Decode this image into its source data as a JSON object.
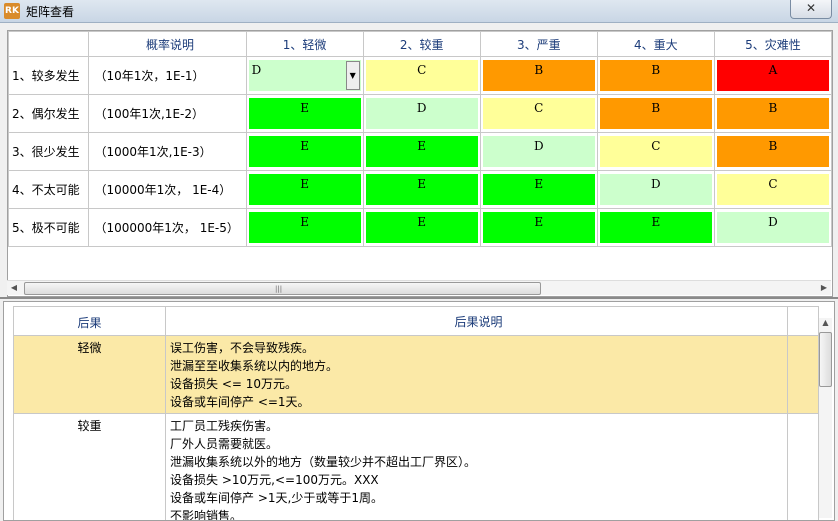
{
  "window": {
    "title": "矩阵查看",
    "icon": "app-icon",
    "close_label": "✕"
  },
  "matrix": {
    "headers": [
      "",
      "概率说明",
      "1、轻微",
      "2、较重",
      "3、严重",
      "4、重大",
      "5、灾难性"
    ],
    "rows": [
      {
        "label": "1、较多发生",
        "prob": "（10年1次，1E-1）",
        "cells": [
          {
            "v": "D",
            "color": "#ccffcc",
            "dropdown": true
          },
          {
            "v": "C",
            "color": "#ffff99"
          },
          {
            "v": "B",
            "color": "#ff9900"
          },
          {
            "v": "B",
            "color": "#ff9900"
          },
          {
            "v": "A",
            "color": "#ff0000"
          }
        ]
      },
      {
        "label": "2、偶尔发生",
        "prob": "（100年1次,1E-2）",
        "cells": [
          {
            "v": "E",
            "color": "#00ff00"
          },
          {
            "v": "D",
            "color": "#ccffcc"
          },
          {
            "v": "C",
            "color": "#ffff99"
          },
          {
            "v": "B",
            "color": "#ff9900"
          },
          {
            "v": "B",
            "color": "#ff9900"
          }
        ]
      },
      {
        "label": "3、很少发生",
        "prob": "（1000年1次,1E-3）",
        "cells": [
          {
            "v": "E",
            "color": "#00ff00"
          },
          {
            "v": "E",
            "color": "#00ff00"
          },
          {
            "v": "D",
            "color": "#ccffcc"
          },
          {
            "v": "C",
            "color": "#ffff99"
          },
          {
            "v": "B",
            "color": "#ff9900"
          }
        ]
      },
      {
        "label": "4、不太可能",
        "prob": "（10000年1次， 1E-4）",
        "cells": [
          {
            "v": "E",
            "color": "#00ff00"
          },
          {
            "v": "E",
            "color": "#00ff00"
          },
          {
            "v": "E",
            "color": "#00ff00"
          },
          {
            "v": "D",
            "color": "#ccffcc"
          },
          {
            "v": "C",
            "color": "#ffff99"
          }
        ]
      },
      {
        "label": "5、极不可能",
        "prob": "（100000年1次， 1E-5）",
        "cells": [
          {
            "v": "E",
            "color": "#00ff00"
          },
          {
            "v": "E",
            "color": "#00ff00"
          },
          {
            "v": "E",
            "color": "#00ff00"
          },
          {
            "v": "E",
            "color": "#00ff00"
          },
          {
            "v": "D",
            "color": "#ccffcc"
          }
        ]
      }
    ]
  },
  "consequences": {
    "headers": [
      "后果",
      "后果说明"
    ],
    "rows": [
      {
        "name": "轻微",
        "selected": true,
        "lines": [
          "误工伤害，不会导致残疾。",
          "泄漏至至收集系统以内的地方。",
          "设备损失 <= 10万元。",
          "设备或车间停产 <=1天。"
        ]
      },
      {
        "name": "较重",
        "selected": false,
        "lines": [
          "工厂员工残疾伤害。",
          "厂外人员需要就医。",
          "泄漏收集系统以外的地方（数量较少并不超出工厂界区）。",
          "设备损失 >10万元,<=100万元。XXX",
          "设备或车间停产 >1天,少于或等于1周。",
          "不影响销售。"
        ]
      }
    ]
  },
  "scrollbar": {
    "grip": "|||",
    "left_arrow": "◀",
    "right_arrow": "▶",
    "up_arrow": "▲"
  }
}
